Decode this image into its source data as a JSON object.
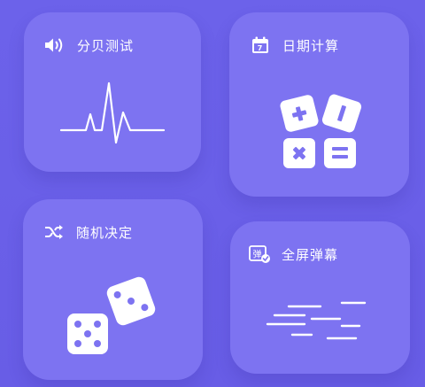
{
  "cards": [
    {
      "id": "decibel",
      "title": "分贝测试",
      "icon": "speaker-icon"
    },
    {
      "id": "date",
      "title": "日期计算",
      "icon": "calendar-icon",
      "icon_text": "7"
    },
    {
      "id": "random",
      "title": "随机决定",
      "icon": "shuffle-icon"
    },
    {
      "id": "bullet",
      "title": "全屏弹幕",
      "icon": "danmaku-icon",
      "icon_text": "弹"
    }
  ],
  "colors": {
    "background": "#6a5fe6",
    "card": "#7d73f1",
    "foreground": "#ffffff"
  }
}
